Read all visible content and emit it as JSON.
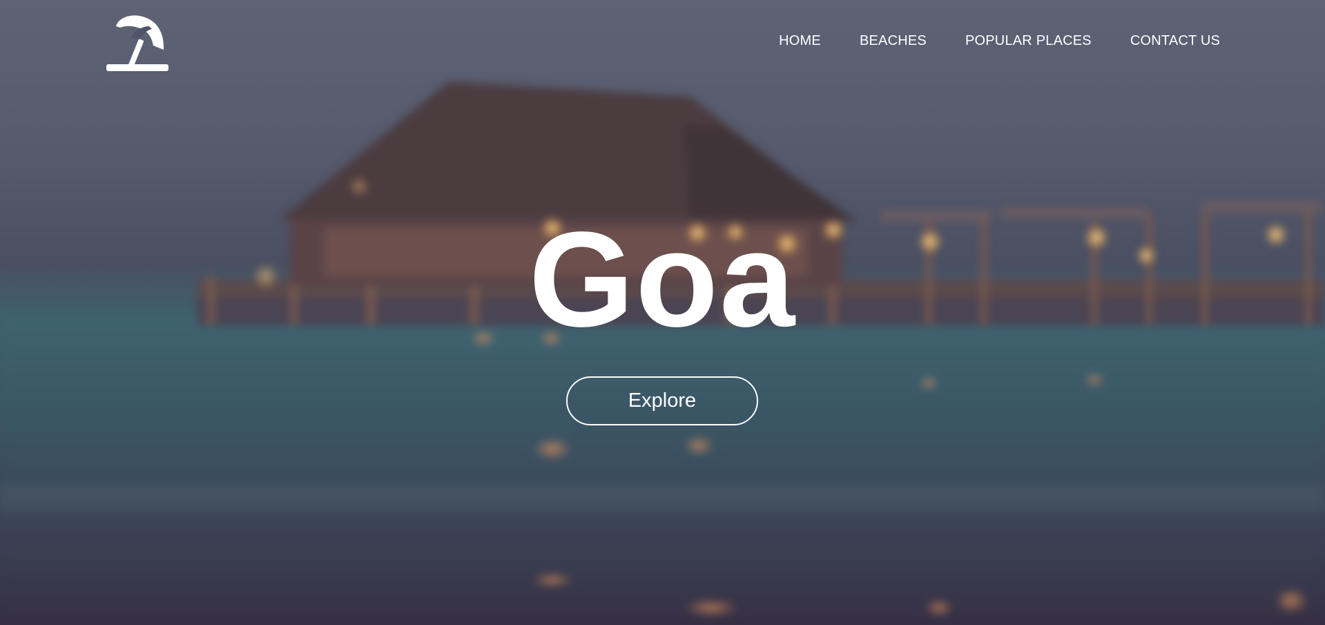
{
  "logo": {
    "icon": "beach-umbrella-icon"
  },
  "nav": {
    "items": [
      {
        "label": "HOME"
      },
      {
        "label": "BEACHES"
      },
      {
        "label": "POPULAR PLACES"
      },
      {
        "label": "CONTACT US"
      }
    ]
  },
  "hero": {
    "title": "Goa",
    "button_label": "Explore",
    "background": "blurred-beach-pier-at-dusk"
  },
  "colors": {
    "text": "#ffffff",
    "sky": "#5d6375",
    "water": "#3a5866",
    "lights": "#ffcf7a"
  }
}
